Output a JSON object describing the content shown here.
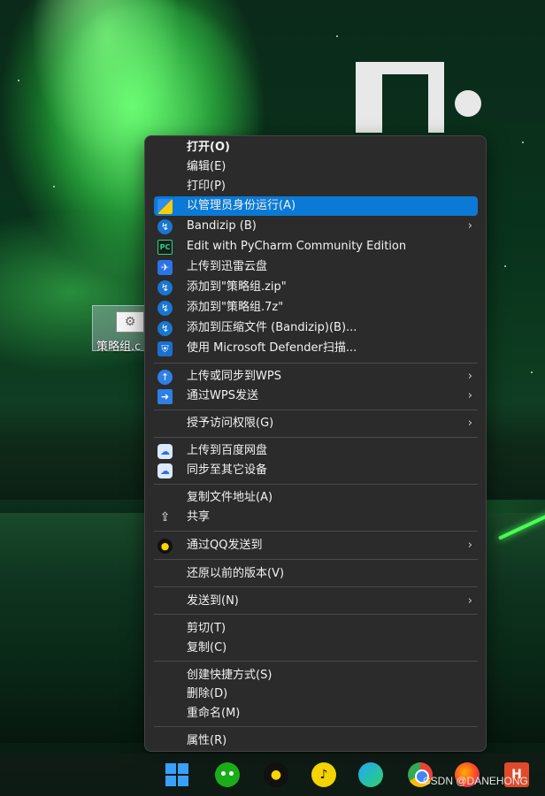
{
  "desktop_file": {
    "name": "策略组.c",
    "icon": "gear-icon"
  },
  "menu": {
    "items": [
      {
        "label": "打开(O)",
        "icon": "",
        "bold": true,
        "has_submenu": false
      },
      {
        "label": "编辑(E)",
        "icon": "",
        "has_submenu": false
      },
      {
        "label": "打印(P)",
        "icon": "",
        "has_submenu": false
      },
      {
        "label": "以管理员身份运行(A)",
        "icon": "uac-shield-icon",
        "highlighted": true,
        "has_submenu": false
      },
      {
        "label": "Bandizip (B)",
        "icon": "bandizip-icon",
        "has_submenu": true
      },
      {
        "label": "Edit with PyCharm Community Edition",
        "icon": "pycharm-icon",
        "has_submenu": false
      },
      {
        "label": "上传到迅雷云盘",
        "icon": "thunder-icon",
        "has_submenu": false
      },
      {
        "label": "添加到\"策略组.zip\"",
        "icon": "bandizip-icon",
        "has_submenu": false
      },
      {
        "label": "添加到\"策略组.7z\"",
        "icon": "bandizip-icon",
        "has_submenu": false
      },
      {
        "label": "添加到压缩文件 (Bandizip)(B)...",
        "icon": "bandizip-icon",
        "has_submenu": false
      },
      {
        "label": "使用 Microsoft Defender扫描...",
        "icon": "defender-icon",
        "has_submenu": false
      },
      {
        "label": "上传或同步到WPS",
        "icon": "wps-cloud-icon",
        "has_submenu": true
      },
      {
        "label": "通过WPS发送",
        "icon": "wps-send-icon",
        "has_submenu": true
      },
      {
        "label": "授予访问权限(G)",
        "icon": "",
        "has_submenu": true
      },
      {
        "label": "上传到百度网盘",
        "icon": "baidu-netdisk-icon",
        "has_submenu": false
      },
      {
        "label": "同步至其它设备",
        "icon": "baidu-netdisk-icon",
        "has_submenu": false
      },
      {
        "label": "复制文件地址(A)",
        "icon": "",
        "has_submenu": false
      },
      {
        "label": "共享",
        "icon": "share-icon",
        "has_submenu": false
      },
      {
        "label": "通过QQ发送到",
        "icon": "qq-icon",
        "has_submenu": true
      },
      {
        "label": "还原以前的版本(V)",
        "icon": "",
        "has_submenu": false
      },
      {
        "label": "发送到(N)",
        "icon": "",
        "has_submenu": true
      },
      {
        "label": "剪切(T)",
        "icon": "",
        "has_submenu": false
      },
      {
        "label": "复制(C)",
        "icon": "",
        "has_submenu": false
      },
      {
        "label": "创建快捷方式(S)",
        "icon": "",
        "has_submenu": false
      },
      {
        "label": "删除(D)",
        "icon": "",
        "has_submenu": false
      },
      {
        "label": "重命名(M)",
        "icon": "",
        "has_submenu": false
      },
      {
        "label": "属性(R)",
        "icon": "",
        "has_submenu": false
      }
    ],
    "submenu_arrow": "›"
  },
  "taskbar": {
    "apps": [
      "windows-start-icon",
      "wechat-icon",
      "qq-icon",
      "music-icon",
      "edge-icon",
      "chrome-icon",
      "firefox-icon",
      "h-app-icon"
    ],
    "h_app_letter": "H"
  },
  "watermark": "CSDN @DANEHONG",
  "colors": {
    "menu_bg": "#2b2b2b",
    "highlight": "#0a7ad6",
    "text": "#f2f2f2"
  }
}
